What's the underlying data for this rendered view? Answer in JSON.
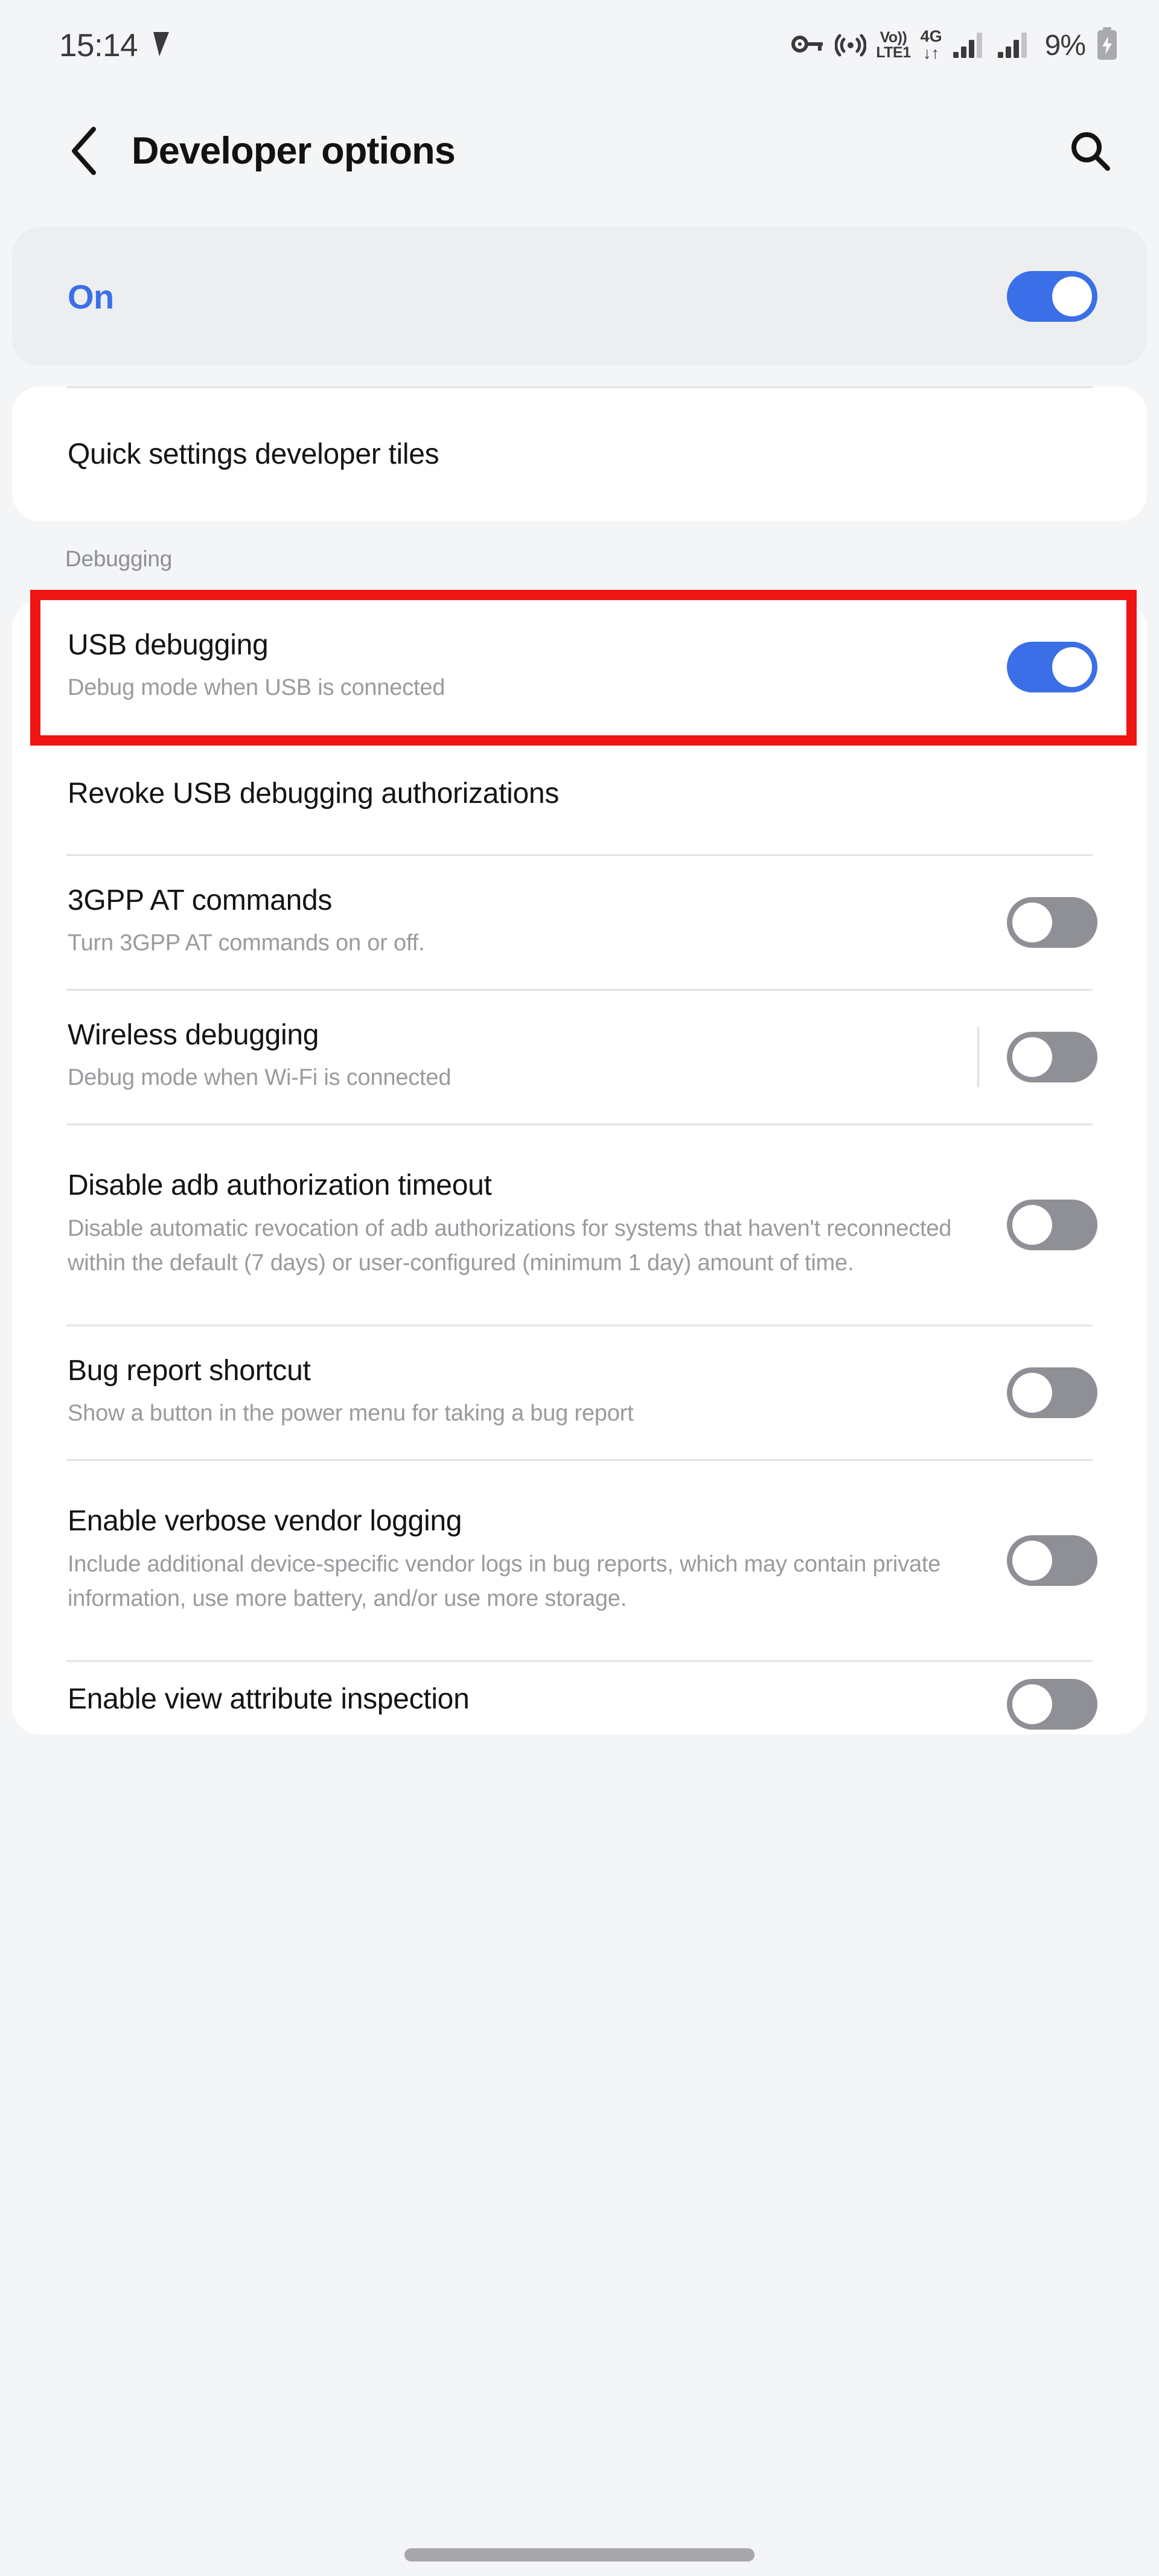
{
  "status_bar": {
    "time": "15:14",
    "nav_arrow_icon": "navigation-arrow-icon",
    "icons": [
      {
        "name": "vpn-key-icon",
        "label": "VPN"
      },
      {
        "name": "hotspot-icon",
        "label": "Hotspot"
      }
    ],
    "volte": {
      "line1": "Vo))",
      "line2": "LTE1"
    },
    "network": {
      "line1": "4G",
      "line2": "↓↑"
    },
    "signal_bars_1": "signal-bars-icon",
    "signal_bars_2": "signal-bars-icon",
    "battery_percent": "9%",
    "battery_icon": "battery-charging-icon"
  },
  "header": {
    "back_icon": "back-chevron-icon",
    "title": "Developer options",
    "search_icon": "search-icon"
  },
  "master_switch": {
    "label": "On",
    "state": "on",
    "accent_color": "#3b6fe8"
  },
  "colors": {
    "page_background": "#f4f5f7",
    "card_background": "#ffffff",
    "master_card_background": "#eceef0",
    "toggle_on": "#3b6fe8",
    "toggle_off": "#8f9096",
    "accent_blue": "#3a6fe8",
    "highlight_red": "#ee1513",
    "title_text": "#141414",
    "subtitle_text": "#9a9a9f",
    "divider": "#e3e4e6"
  },
  "quick_settings_card": {
    "rows": [
      {
        "title": "Quick settings developer tiles",
        "subtitle": "",
        "toggle": null
      }
    ]
  },
  "sections": [
    {
      "label": "Debugging",
      "rows": [
        {
          "title": "USB debugging",
          "subtitle": "Debug mode when USB is connected",
          "toggle": "on",
          "highlighted": true,
          "has_separator": false
        },
        {
          "title": "Revoke USB debugging authorizations",
          "subtitle": "",
          "toggle": null,
          "highlighted": false,
          "has_separator": false
        },
        {
          "title": "3GPP AT commands",
          "subtitle": "Turn 3GPP AT commands on or off.",
          "toggle": "off",
          "highlighted": false,
          "has_separator": false
        },
        {
          "title": "Wireless debugging",
          "subtitle": "Debug mode when Wi-Fi is connected",
          "toggle": "off",
          "highlighted": false,
          "has_separator": true
        },
        {
          "title": "Disable adb authorization timeout",
          "subtitle": "Disable automatic revocation of adb authorizations for systems that haven't reconnected within the default (7 days) or user-configured (minimum 1 day) amount of time.",
          "toggle": "off",
          "highlighted": false,
          "has_separator": false
        },
        {
          "title": "Bug report shortcut",
          "subtitle": "Show a button in the power menu for taking a bug report",
          "toggle": "off",
          "highlighted": false,
          "has_separator": false
        },
        {
          "title": "Enable verbose vendor logging",
          "subtitle": "Include additional device-specific vendor logs in bug reports, which may contain private information, use more battery, and/or use more storage.",
          "toggle": "off",
          "highlighted": false,
          "has_separator": false
        },
        {
          "title": "Enable view attribute inspection",
          "subtitle": "",
          "toggle": "off",
          "highlighted": false,
          "has_separator": false,
          "clipped": true
        }
      ]
    }
  ],
  "gesture_bar": {
    "name": "home-gesture-handle"
  }
}
